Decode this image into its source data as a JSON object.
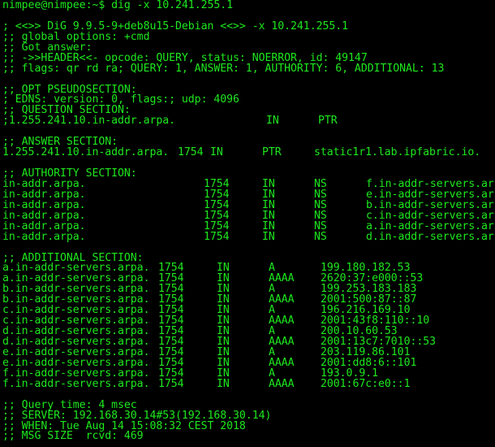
{
  "prompt": {
    "user_host": "nimpee@nimpee:~$",
    "command": "dig -x 10.241.255.1"
  },
  "header": [
    "; <<>> DiG 9.9.5-9+deb8u15-Debian <<>> -x 10.241.255.1",
    ";; global options: +cmd",
    ";; Got answer:",
    ";; ->>HEADER<<- opcode: QUERY, status: NOERROR, id: 49147",
    ";; flags: qr rd ra; QUERY: 1, ANSWER: 1, AUTHORITY: 6, ADDITIONAL: 13"
  ],
  "opt": {
    "title": ";; OPT PSEUDOSECTION:",
    "edns": "; EDNS: version: 0, flags:; udp: 4096"
  },
  "question": {
    "title": ";; QUESTION SECTION:",
    "row": {
      "name": ";1.255.241.10.in-addr.arpa.",
      "ttl": "",
      "class": "IN",
      "type": "PTR",
      "data": ""
    }
  },
  "answer": {
    "title": ";; ANSWER SECTION:",
    "rows": [
      {
        "name": "1.255.241.10.in-addr.arpa.",
        "ttl": "1754",
        "class": "IN",
        "type": "PTR",
        "data": "static1r1.lab.ipfabric.io."
      }
    ]
  },
  "authority": {
    "title": ";; AUTHORITY SECTION:",
    "rows": [
      {
        "name": "in-addr.arpa.",
        "ttl": "1754",
        "class": "IN",
        "type": "NS",
        "data": "f.in-addr-servers.arpa."
      },
      {
        "name": "in-addr.arpa.",
        "ttl": "1754",
        "class": "IN",
        "type": "NS",
        "data": "e.in-addr-servers.arpa."
      },
      {
        "name": "in-addr.arpa.",
        "ttl": "1754",
        "class": "IN",
        "type": "NS",
        "data": "b.in-addr-servers.arpa."
      },
      {
        "name": "in-addr.arpa.",
        "ttl": "1754",
        "class": "IN",
        "type": "NS",
        "data": "c.in-addr-servers.arpa."
      },
      {
        "name": "in-addr.arpa.",
        "ttl": "1754",
        "class": "IN",
        "type": "NS",
        "data": "a.in-addr-servers.arpa."
      },
      {
        "name": "in-addr.arpa.",
        "ttl": "1754",
        "class": "IN",
        "type": "NS",
        "data": "d.in-addr-servers.arpa."
      }
    ]
  },
  "additional": {
    "title": ";; ADDITIONAL SECTION:",
    "rows": [
      {
        "name": "a.in-addr-servers.arpa.",
        "ttl": "1754",
        "class": "IN",
        "type": "A",
        "data": "199.180.182.53"
      },
      {
        "name": "a.in-addr-servers.arpa.",
        "ttl": "1754",
        "class": "IN",
        "type": "AAAA",
        "data": "2620:37:e000::53"
      },
      {
        "name": "b.in-addr-servers.arpa.",
        "ttl": "1754",
        "class": "IN",
        "type": "A",
        "data": "199.253.183.183"
      },
      {
        "name": "b.in-addr-servers.arpa.",
        "ttl": "1754",
        "class": "IN",
        "type": "AAAA",
        "data": "2001:500:87::87"
      },
      {
        "name": "c.in-addr-servers.arpa.",
        "ttl": "1754",
        "class": "IN",
        "type": "A",
        "data": "196.216.169.10"
      },
      {
        "name": "c.in-addr-servers.arpa.",
        "ttl": "1754",
        "class": "IN",
        "type": "AAAA",
        "data": "2001:43f8:110::10"
      },
      {
        "name": "d.in-addr-servers.arpa.",
        "ttl": "1754",
        "class": "IN",
        "type": "A",
        "data": "200.10.60.53"
      },
      {
        "name": "d.in-addr-servers.arpa.",
        "ttl": "1754",
        "class": "IN",
        "type": "AAAA",
        "data": "2001:13c7:7010::53"
      },
      {
        "name": "e.in-addr-servers.arpa.",
        "ttl": "1754",
        "class": "IN",
        "type": "A",
        "data": "203.119.86.101"
      },
      {
        "name": "e.in-addr-servers.arpa.",
        "ttl": "1754",
        "class": "IN",
        "type": "AAAA",
        "data": "2001:dd8:6::101"
      },
      {
        "name": "f.in-addr-servers.arpa.",
        "ttl": "1754",
        "class": "IN",
        "type": "A",
        "data": "193.0.9.1"
      },
      {
        "name": "f.in-addr-servers.arpa.",
        "ttl": "1754",
        "class": "IN",
        "type": "AAAA",
        "data": "2001:67c:e0::1"
      }
    ]
  },
  "footer": [
    ";; Query time: 4 msec",
    ";; SERVER: 192.168.30.14#53(192.168.30.14)",
    ";; WHEN: Tue Aug 14 15:08:32 CEST 2018",
    ";; MSG SIZE  rcvd: 469"
  ],
  "colors": {
    "background": "#000000",
    "foreground": "#1ee81e"
  }
}
